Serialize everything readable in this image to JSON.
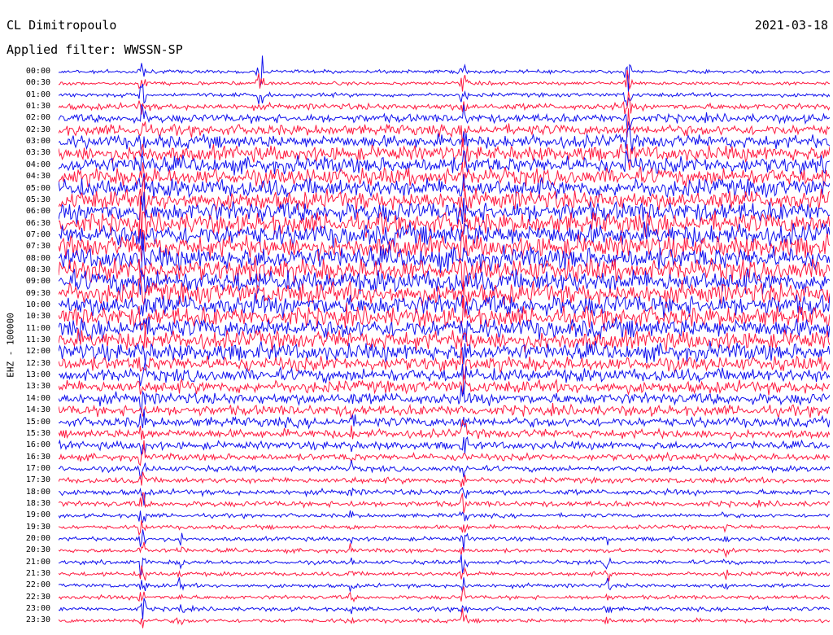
{
  "header": {
    "station": "CL Dimitropoulo",
    "filter": "Applied filter: WWSSN-SP",
    "date": "2021-03-18"
  },
  "channel_label": "EHZ - 100000",
  "trace_colors": [
    "#1010ee",
    "#ff1a40"
  ],
  "time_labels": [
    "00:00",
    "00:30",
    "01:00",
    "01:30",
    "02:00",
    "02:30",
    "03:00",
    "03:30",
    "04:00",
    "04:30",
    "05:00",
    "05:30",
    "06:00",
    "06:30",
    "07:00",
    "07:30",
    "08:00",
    "08:30",
    "09:00",
    "09:30",
    "10:00",
    "10:30",
    "11:00",
    "11:30",
    "12:00",
    "12:30",
    "13:00",
    "13:30",
    "14:00",
    "14:30",
    "15:00",
    "15:30",
    "16:00",
    "16:30",
    "17:00",
    "17:30",
    "18:00",
    "18:30",
    "19:00",
    "19:30",
    "20:00",
    "20:30",
    "21:00",
    "21:30",
    "22:00",
    "22:30",
    "23:00",
    "23:30"
  ]
}
